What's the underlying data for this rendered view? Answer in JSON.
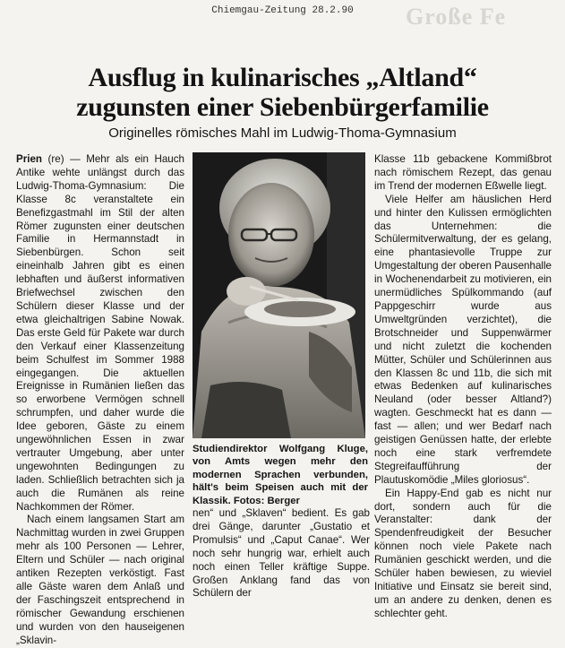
{
  "source_note": "Chiemgau-Zeitung 28.2.90",
  "ghost_text": "Große Fe",
  "headline": [
    "Ausflug in kulinarisches „Altland“",
    "zugunsten einer Siebenbürgerfamilie"
  ],
  "subhead": "Originelles römisches Mahl im Ludwig-Thoma-Gymnasium",
  "column1": {
    "dateline": "Prien",
    "paragraphs": [
      " (re) — Mehr als ein Hauch Antike wehte unlängst durch das Ludwig-Thoma-Gymnasium: Die Klasse 8c veranstaltete ein Benefizgastmahl im Stil der alten Römer zugunsten einer deutschen Familie in Hermannstadt in Siebenbürgen. Schon seit eineinhalb Jahren gibt es einen lebhaften und äußerst informativen Briefwechsel zwischen den Schülern dieser Klasse und der etwa gleichaltrigen Sabine Nowak. Das erste Geld für Pakete war durch den Verkauf einer Klassenzeitung beim Schulfest im Sommer 1988 eingegangen. Die aktuellen Ereignisse in Rumänien ließen das so erworbene Vermögen schnell schrumpfen, und daher wurde die Idee geboren, Gäste zu einem ungewöhnlichen Essen in zwar vertrauter Umgebung, aber unter ungewohnten Bedingungen zu laden. Schließlich betrachten sich ja auch die Rumänen als reine Nachkommen der Römer.",
      "Nach einem langsamen Start am Nachmittag wurden in zwei Gruppen mehr als 100 Personen — Lehrer, Eltern und Schüler — nach original antiken Rezepten verköstigt. Fast alle Gäste waren dem Anlaß und der Faschingszeit entsprechend in römischer Gewandung erschienen und wurden von den hauseigenen „Sklavin-"
    ]
  },
  "column2": "nen“ und „Sklaven“ bedient. Es gab drei Gänge, darunter „Gustatio et Promulsis“ und „Caput Canae“. Wer noch sehr hungrig war, erhielt auch noch einen Teller kräftige Suppe. Großen Anklang fand das von Schülern der",
  "column3": [
    "Klasse 11b gebackene Kommißbrot nach römischem Rezept, das genau im Trend der modernen Eßwelle liegt.",
    "Viele Helfer am häuslichen Herd und hinter den Kulissen ermöglichten das Unternehmen: die Schülermitverwaltung, der es gelang, eine phantasievolle Truppe zur Umgestaltung der oberen Pausenhalle in Wochenendarbeit zu motivieren, ein unermüdliches Spülkommando (auf Pappgeschirr wurde aus Umweltgründen verzichtet), die Brotschneider und Suppenwärmer und nicht zuletzt die kochenden Mütter, Schüler und Schülerinnen aus den Klassen 8c und 11b, die sich mit etwas Bedenken auf kulinarisches Neuland (oder besser Altland?) wagten. Geschmeckt hat es dann — fast — allen; und wer Bedarf nach geistigen Genüssen hatte, der erlebte noch eine stark verfremdete Stegreifaufführung der Plautuskomödie „Miles gloriosus“.",
    "Ein Happy-End gab es nicht nur dort, sondern auch für die Veranstalter: dank der Spendenfreudigkeit der Besucher können noch viele Pakete nach Rumänien geschickt werden, und die Schüler haben bewiesen, zu wieviel Initiative und Einsatz sie bereit sind, um an andere zu denken, denen es schlechter geht."
  ],
  "photo_caption": "Studiendirektor Wolfgang Kluge, von Amts wegen mehr den modernen Sprachen verbunden, hält's beim Speisen auch mit der Klassik. Fotos: Berger"
}
